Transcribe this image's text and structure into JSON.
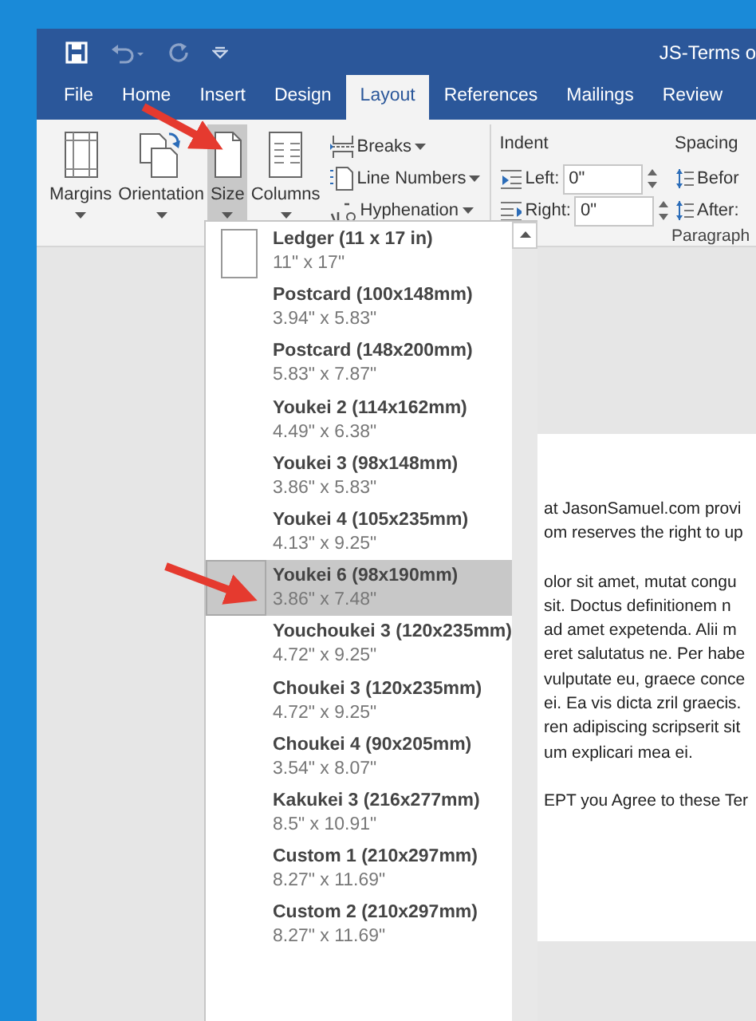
{
  "window": {
    "title": "JS-Terms o"
  },
  "tabs": [
    {
      "label": "File",
      "selected": false
    },
    {
      "label": "Home",
      "selected": false
    },
    {
      "label": "Insert",
      "selected": false
    },
    {
      "label": "Design",
      "selected": false
    },
    {
      "label": "Layout",
      "selected": true
    },
    {
      "label": "References",
      "selected": false
    },
    {
      "label": "Mailings",
      "selected": false
    },
    {
      "label": "Review",
      "selected": false
    }
  ],
  "ribbon": {
    "large_buttons": [
      {
        "label": "Margins",
        "kind": "margins",
        "pressed": false
      },
      {
        "label": "Orientation",
        "kind": "orientation",
        "pressed": false
      },
      {
        "label": "Size",
        "kind": "size",
        "pressed": true
      },
      {
        "label": "Columns",
        "kind": "columns",
        "pressed": false
      }
    ],
    "small_buttons": [
      {
        "label": "Breaks",
        "kind": "breaks"
      },
      {
        "label": "Line Numbers",
        "kind": "line-numbers"
      },
      {
        "label": "Hyphenation",
        "kind": "hyphenation"
      }
    ],
    "indent": {
      "title": "Indent",
      "left_label": "Left:",
      "left_value": "0\"",
      "right_label": "Right:",
      "right_value": "0\""
    },
    "spacing": {
      "title": "Spacing",
      "before_label": "Befor",
      "after_label": "After:"
    },
    "group_label": "Paragraph"
  },
  "size_menu": {
    "items": [
      {
        "name": "Ledger (11 x 17 in)",
        "size": "11\" x 17\"",
        "icon": true,
        "selected": false
      },
      {
        "name": "Postcard (100x148mm)",
        "size": "3.94\" x 5.83\"",
        "icon": false,
        "selected": false
      },
      {
        "name": "Postcard (148x200mm)",
        "size": "5.83\" x 7.87\"",
        "icon": false,
        "selected": false
      },
      {
        "name": "Youkei 2 (114x162mm)",
        "size": "4.49\" x 6.38\"",
        "icon": false,
        "selected": false
      },
      {
        "name": "Youkei 3 (98x148mm)",
        "size": "3.86\" x 5.83\"",
        "icon": false,
        "selected": false
      },
      {
        "name": "Youkei 4 (105x235mm)",
        "size": "4.13\" x 9.25\"",
        "icon": false,
        "selected": false
      },
      {
        "name": "Youkei 6 (98x190mm)",
        "size": "3.86\" x 7.48\"",
        "icon": false,
        "selected": true
      },
      {
        "name": "Youchoukei 3 (120x235mm)",
        "size": "4.72\" x 9.25\"",
        "icon": false,
        "selected": false
      },
      {
        "name": "Choukei 3 (120x235mm)",
        "size": "4.72\" x 9.25\"",
        "icon": false,
        "selected": false
      },
      {
        "name": "Choukei 4 (90x205mm)",
        "size": "3.54\" x 8.07\"",
        "icon": false,
        "selected": false
      },
      {
        "name": "Kakukei 3 (216x277mm)",
        "size": "8.5\" x 10.91\"",
        "icon": false,
        "selected": false
      },
      {
        "name": "Custom 1 (210x297mm)",
        "size": "8.27\" x 11.69\"",
        "icon": false,
        "selected": false
      },
      {
        "name": "Custom 2 (210x297mm)",
        "size": "8.27\" x 11.69\"",
        "icon": false,
        "selected": false
      }
    ]
  },
  "document": {
    "paragraphs": [
      [
        "at JasonSamuel.com provi",
        "om reserves the right to up"
      ],
      [
        "olor sit amet, mutat congu",
        "sit. Doctus definitionem n",
        "ad amet expetenda. Alii m",
        "eret salutatus ne. Per habe",
        "vulputate eu, graece conce",
        "ei. Ea vis dicta zril graecis.",
        "ren adipiscing scripserit sit",
        "um explicari mea ei."
      ],
      [
        "EPT you Agree to these Ter"
      ]
    ]
  }
}
